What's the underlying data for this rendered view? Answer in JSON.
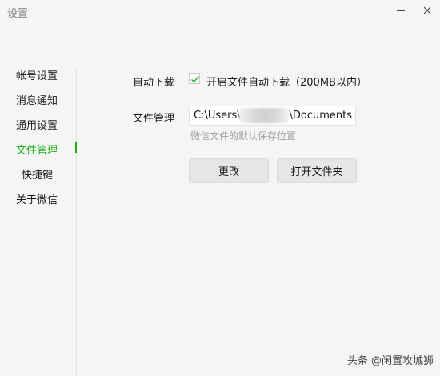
{
  "window": {
    "title": "设置"
  },
  "sidebar": {
    "items": [
      {
        "label": "帐号设置"
      },
      {
        "label": "消息通知"
      },
      {
        "label": "通用设置"
      },
      {
        "label": "文件管理"
      },
      {
        "label": "快捷键"
      },
      {
        "label": "关于微信"
      }
    ],
    "active": "文件管理"
  },
  "auto_download": {
    "label": "自动下载",
    "checked": true,
    "option_label": "开启文件自动下载（200MB以内）"
  },
  "file_management": {
    "label": "文件管理",
    "path_prefix": "C:\\Users\\",
    "path_suffix": "\\Documents",
    "hint": "微信文件的默认保存位置"
  },
  "buttons": {
    "change": "更改",
    "open_folder": "打开文件夹"
  },
  "watermark": "头条 @闲置攻城狮",
  "colors": {
    "accent": "#1aad19",
    "background": "#f5f5f5"
  }
}
